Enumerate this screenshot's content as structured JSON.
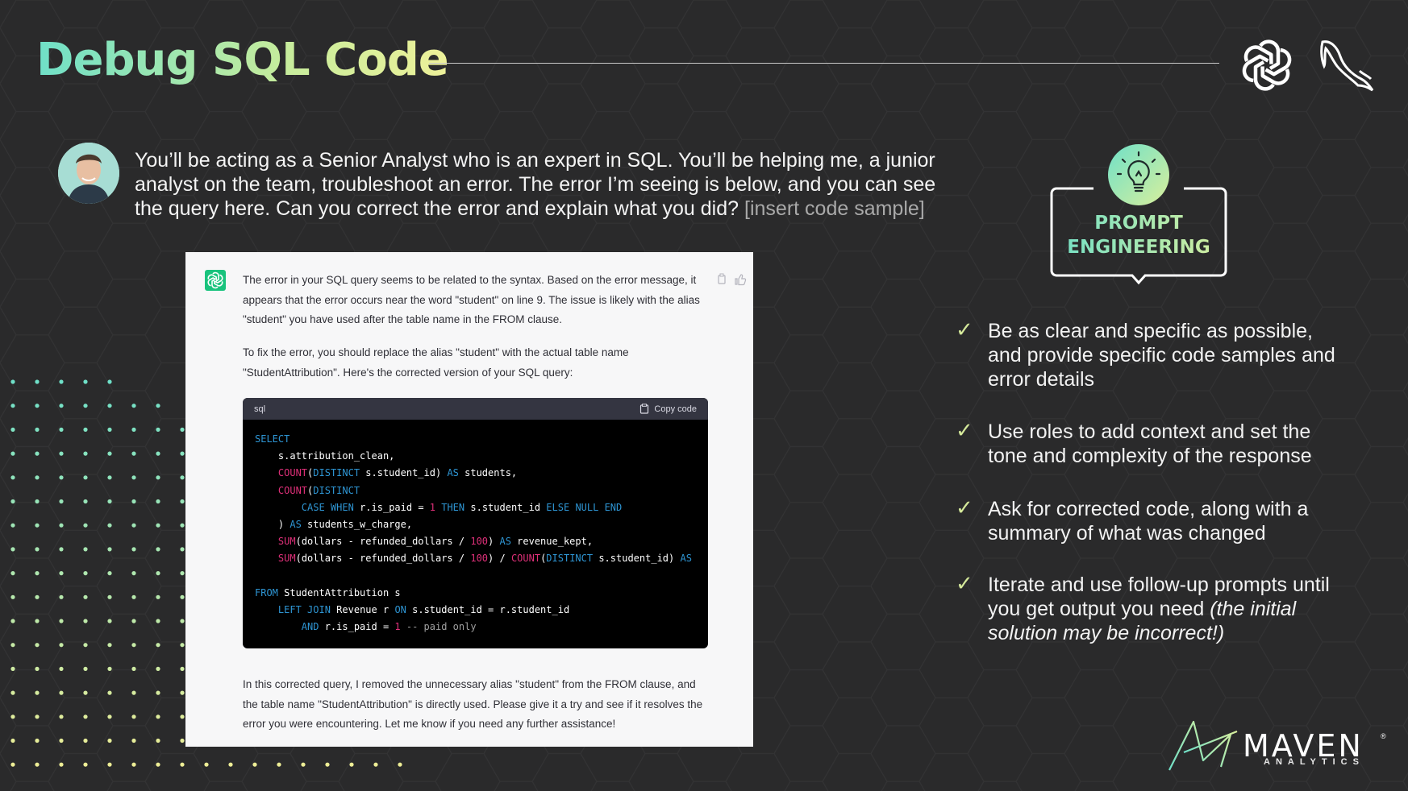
{
  "slide": {
    "title": "Debug SQL Code"
  },
  "prompt": {
    "text": "You’ll be acting as a Senior Analyst who is an expert in SQL. You’ll be helping me, a junior analyst on the team, troubleshoot an error. The error I’m seeing is below, and you can see the query here. Can you correct the error and explain what you did?",
    "placeholder": "[insert code sample]"
  },
  "chat": {
    "para1": "The error in your SQL query seems to be related to the syntax. Based on the error message, it appears that the error occurs near the word \"student\" on line 9. The issue is likely with the alias \"student\" you have used after the table name in the FROM clause.",
    "para2": "To fix the error, you should replace the alias \"student\" with the actual table name \"StudentAttribution\". Here's the corrected version of your SQL query:",
    "code_lang": "sql",
    "copy_label": "Copy code",
    "para3": "In this corrected query, I removed the unnecessary alias \"student\" from the FROM clause, and the table name \"StudentAttribution\" is directly used. Please give it a try and see if it resolves the error you were encountering. Let me know if you need any further assistance!"
  },
  "badge": {
    "line1": "PROMPT",
    "line2": "ENGINEERING"
  },
  "bullets": {
    "b1": "Be as clear and specific as possible, and provide specific code samples and error details",
    "b2": "Use roles to add context and set the tone and complexity of the response",
    "b3": "Ask for corrected code, along with a summary of what was changed",
    "b4_main": "Iterate and use follow-up prompts until you get output you need",
    "b4_italic": "(the initial solution may be incorrect!)"
  },
  "brand": {
    "name": "MAVEN",
    "sub": "ANALYTICS",
    "reg": "®"
  },
  "icons": [
    "openai-logo-icon",
    "mysql-dolphin-icon",
    "lightbulb-icon",
    "copy-icon",
    "thumbs-up-icon",
    "checkmark-icon"
  ],
  "colors": {
    "background": "#2a2a2b",
    "title_gradient_start": "#6fe0c8",
    "title_gradient_end": "#eef19a",
    "code_keyword": "#2e95d3",
    "code_function": "#df3079",
    "check": "#d4e89a"
  }
}
